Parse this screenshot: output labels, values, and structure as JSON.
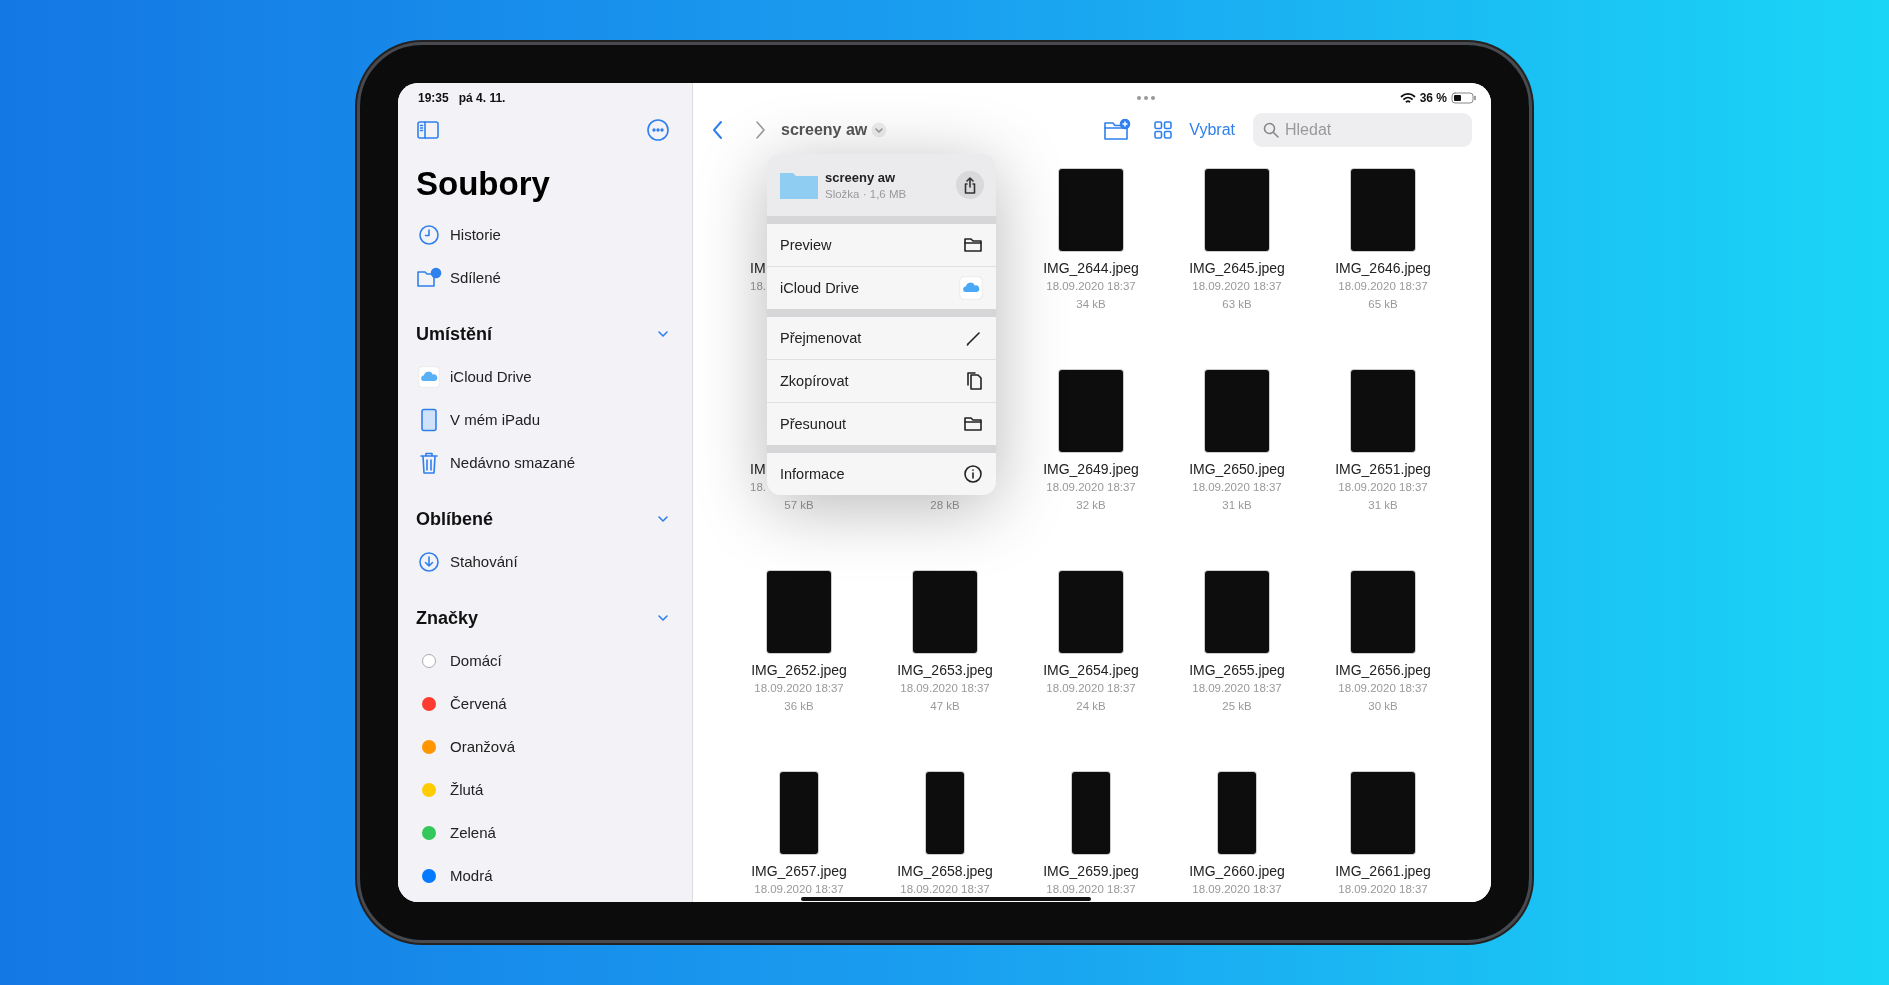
{
  "sidebar": {
    "status_time": "19:35",
    "status_date": "pá 4. 11.",
    "title": "Soubory",
    "sections": [
      {
        "items": [
          {
            "label": "Historie"
          },
          {
            "label": "Sdílené"
          }
        ]
      },
      {
        "title": "Umístění",
        "expanded": true,
        "items": [
          {
            "label": "iCloud Drive"
          },
          {
            "label": "V mém iPadu"
          },
          {
            "label": "Nedávno smazané"
          }
        ]
      },
      {
        "title": "Oblíbené",
        "expanded": true,
        "items": [
          {
            "label": "Stahování"
          }
        ]
      },
      {
        "title": "Značky",
        "expanded": true,
        "tags": [
          {
            "label": "Domácí"
          },
          {
            "label": "Červená",
            "color": "#ff3b30"
          },
          {
            "label": "Oranžová",
            "color": "#ff9500"
          },
          {
            "label": "Žlutá",
            "color": "#ffcc00"
          },
          {
            "label": "Zelená",
            "color": "#34c759"
          },
          {
            "label": "Modrá",
            "color": "#007aff"
          }
        ]
      }
    ]
  },
  "status_bar": {
    "battery": "36 %"
  },
  "toolbar": {
    "folder": "screeny aw",
    "select": "Vybrat",
    "search": {
      "placeholder": "Hledat"
    }
  },
  "files": {
    "rows": [
      {
        "items": [
          {
            "kind": "covered",
            "name": "IM",
            "date": "18."
          },
          {
            "kind": "covered"
          },
          {
            "kind": "watch",
            "name": "IMG_2644.jpeg",
            "date": "18.09.2020 18:37",
            "size": "34 kB"
          },
          {
            "kind": "watch",
            "name": "IMG_2645.jpeg",
            "date": "18.09.2020 18:37",
            "size": "63 kB"
          },
          {
            "kind": "watch",
            "name": "IMG_2646.jpeg",
            "date": "18.09.2020 18:37",
            "size": "65 kB"
          }
        ]
      },
      {
        "items": [
          {
            "kind": "covered",
            "name": "IM",
            "date": "18.",
            "size": "57 kB"
          },
          {
            "kind": "covered",
            "size": "28 kB"
          },
          {
            "kind": "watch",
            "name": "IMG_2649.jpeg",
            "date": "18.09.2020 18:37",
            "size": "32 kB"
          },
          {
            "kind": "watch",
            "name": "IMG_2650.jpeg",
            "date": "18.09.2020 18:37",
            "size": "31 kB"
          },
          {
            "kind": "watch",
            "name": "IMG_2651.jpeg",
            "date": "18.09.2020 18:37",
            "size": "31 kB"
          }
        ]
      },
      {
        "items": [
          {
            "kind": "watch",
            "name": "IMG_2652.jpeg",
            "date": "18.09.2020 18:37",
            "size": "36 kB"
          },
          {
            "kind": "watch",
            "name": "IMG_2653.jpeg",
            "date": "18.09.2020 18:37",
            "size": "47 kB"
          },
          {
            "kind": "watch",
            "name": "IMG_2654.jpeg",
            "date": "18.09.2020 18:37",
            "size": "24 kB"
          },
          {
            "kind": "watch",
            "name": "IMG_2655.jpeg",
            "date": "18.09.2020 18:37",
            "size": "25 kB"
          },
          {
            "kind": "watch",
            "name": "IMG_2656.jpeg",
            "date": "18.09.2020 18:37",
            "size": "30 kB"
          }
        ]
      },
      {
        "items": [
          {
            "kind": "phone",
            "name": "IMG_2657.jpeg",
            "date": "18.09.2020 18:37"
          },
          {
            "kind": "phone",
            "name": "IMG_2658.jpeg",
            "date": "18.09.2020 18:37"
          },
          {
            "kind": "phone",
            "name": "IMG_2659.jpeg",
            "date": "18.09.2020 18:37"
          },
          {
            "kind": "phone",
            "name": "IMG_2660.jpeg",
            "date": "18.09.2020 18:37"
          },
          {
            "kind": "watch",
            "name": "IMG_2661.jpeg",
            "date": "18.09.2020 18:37"
          }
        ]
      }
    ]
  },
  "context_menu": {
    "title": "screeny aw",
    "subtitle": "Složka · 1,6 MB",
    "groups": [
      {
        "items": [
          {
            "label": "Preview"
          },
          {
            "label": "iCloud Drive"
          }
        ]
      },
      {
        "items": [
          {
            "label": "Přejmenovat"
          },
          {
            "label": "Zkopírovat"
          },
          {
            "label": "Přesunout"
          }
        ]
      },
      {
        "items": [
          {
            "label": "Informace"
          }
        ]
      }
    ]
  }
}
